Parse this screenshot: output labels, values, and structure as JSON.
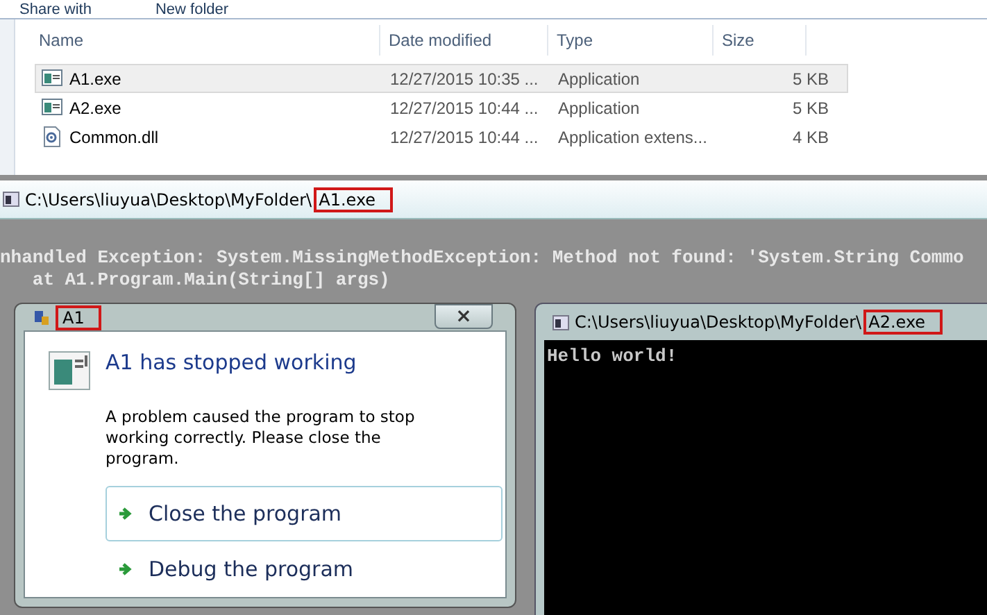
{
  "explorer": {
    "toolbar": [
      "Share with",
      "New folder"
    ],
    "columns": [
      "Name",
      "Date modified",
      "Type",
      "Size"
    ],
    "files": [
      {
        "kind": "exe",
        "name": "A1.exe",
        "date": "12/27/2015 10:35 ...",
        "type": "Application",
        "size": "5 KB",
        "selected": true
      },
      {
        "kind": "exe",
        "name": "A2.exe",
        "date": "12/27/2015 10:44 ...",
        "type": "Application",
        "size": "5 KB",
        "selected": false
      },
      {
        "kind": "dll",
        "name": "Common.dll",
        "date": "12/27/2015 10:44 ...",
        "type": "Application extens...",
        "size": "4 KB",
        "selected": false
      }
    ]
  },
  "console_a1": {
    "title_parts": [
      {
        "text": "C:\\Users\\liuyua\\Desktop\\MyFolder\\",
        "marked": false
      },
      {
        "text": "A1.exe",
        "marked": true
      }
    ],
    "lines": [
      "nhandled Exception: System.MissingMethodException: Method not found: 'System.String Commo",
      "   at A1.Program.Main(String[] args)"
    ]
  },
  "dialog": {
    "title_parts": [
      {
        "text": "A1",
        "marked": true
      }
    ],
    "close": "×",
    "heading": "A1 has stopped working",
    "message": "A problem caused the program to stop working correctly. Please close the program.",
    "options": [
      {
        "label": "Close the program",
        "selected": true
      },
      {
        "label": "Debug the program",
        "selected": false
      }
    ]
  },
  "console_a2": {
    "title_parts": [
      {
        "text": "C:\\Users\\liuyua\\Desktop\\MyFolder\\",
        "marked": false
      },
      {
        "text": "A2.exe",
        "marked": true
      }
    ],
    "lines": [
      "Hello world!"
    ]
  }
}
